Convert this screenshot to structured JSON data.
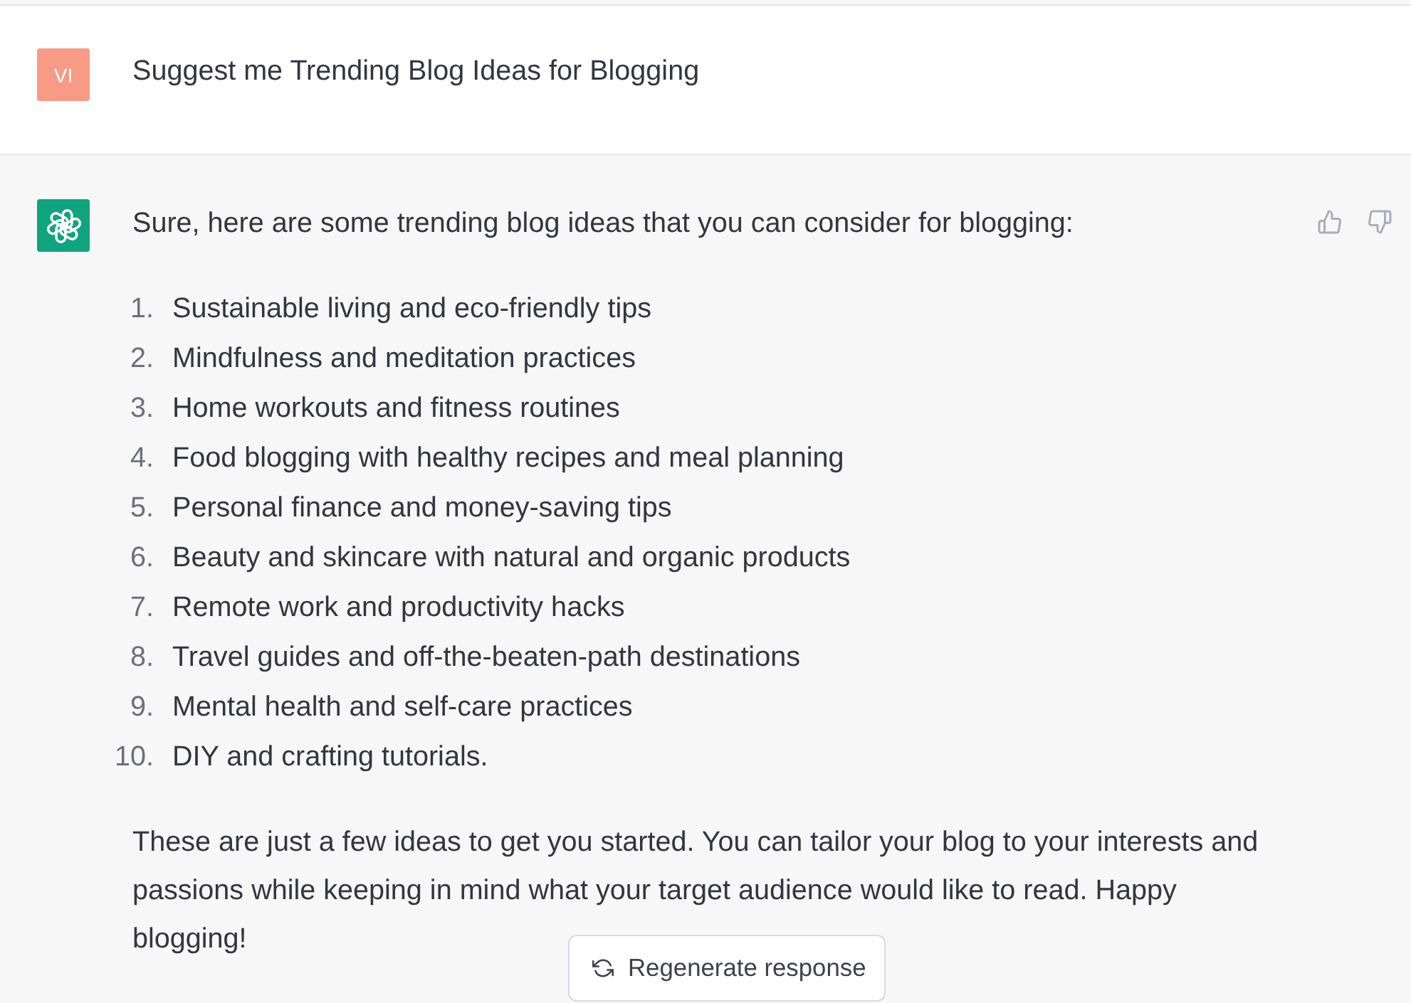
{
  "messages": [
    {
      "kind": "user",
      "avatar": "VI",
      "text": "Suggest me Trending Blog Ideas for Blogging"
    },
    {
      "kind": "assistant",
      "intro": "Sure, here are some trending blog ideas that you can consider for blogging:",
      "list": [
        {
          "number": "1.",
          "text": "Sustainable living and eco-friendly tips"
        },
        {
          "number": "2.",
          "text": "Mindfulness and meditation practices"
        },
        {
          "number": "3.",
          "text": "Home workouts and fitness routines"
        },
        {
          "number": "4.",
          "text": "Food blogging with healthy recipes and meal planning"
        },
        {
          "number": "5.",
          "text": "Personal finance and money-saving tips"
        },
        {
          "number": "6.",
          "text": "Beauty and skincare with natural and organic products"
        },
        {
          "number": "7.",
          "text": "Remote work and productivity hacks"
        },
        {
          "number": "8.",
          "text": "Travel guides and off-the-beaten-path destinations"
        },
        {
          "number": "9.",
          "text": "Mental health and self-care practices"
        },
        {
          "number": "10.",
          "text": "DIY and crafting tutorials."
        }
      ],
      "outro": "These are just a few ideas to get you started. You can tailor your blog to your interests and passions while keeping in mind what your target audience would like to read. Happy blogging!"
    }
  ],
  "regenerate_button": {
    "label": "Regenerate response"
  }
}
